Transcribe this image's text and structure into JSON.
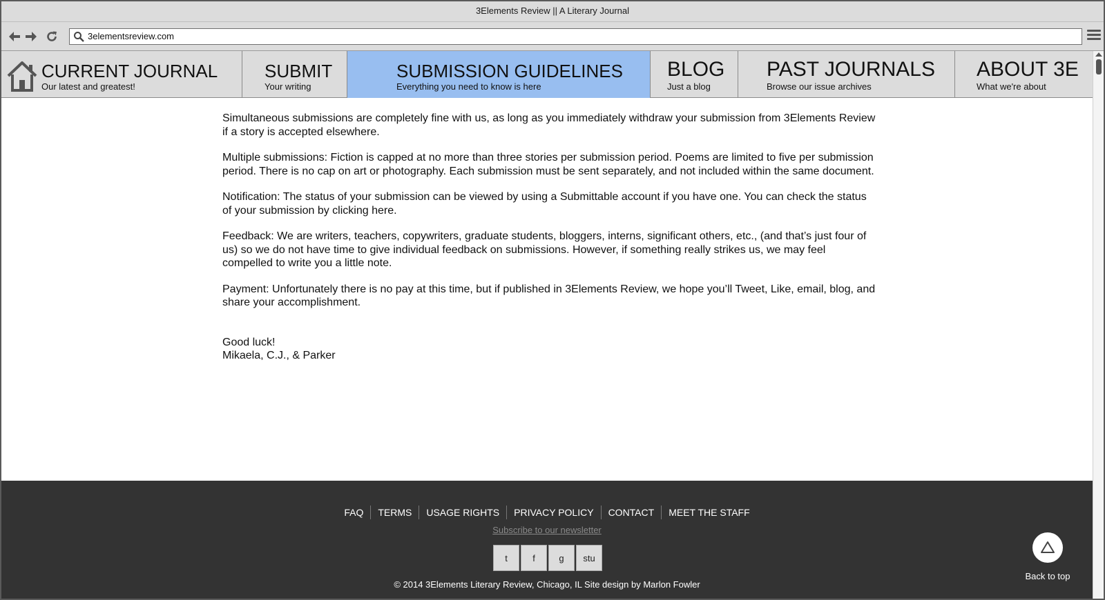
{
  "window": {
    "title": "3Elements Review || A Literary Journal"
  },
  "browser": {
    "url": "3elementsreview.com"
  },
  "nav": {
    "items": [
      {
        "title": "CURRENT JOURNAL",
        "subtitle": "Our latest and greatest!",
        "icon": "home-icon"
      },
      {
        "title": "SUBMIT",
        "subtitle": "Your writing"
      },
      {
        "title": "SUBMISSION GUIDELINES",
        "subtitle": "Everything you need to know is here",
        "active": true
      },
      {
        "title": "BLOG",
        "subtitle": "Just a blog"
      },
      {
        "title": "PAST JOURNALS",
        "subtitle": "Browse our issue archives"
      },
      {
        "title": "ABOUT 3E",
        "subtitle": "What we're about"
      }
    ],
    "active_color": "#98bef0"
  },
  "content": {
    "paragraphs": [
      "Simultaneous submissions are completely fine with us, as long as you immediately withdraw your submission from 3Elements Review if a story is accepted elsewhere.",
      "Multiple submissions: Fiction is capped at no more than three stories per submission period. Poems are limited to five per submission period. There is no cap on art or photography. Each submission must be sent separately, and not included within the same document.",
      "Notification: The status of your submission can be viewed by using a Submittable account if you have one. You can check the status of your submission by clicking here.",
      "Feedback: We are writers, teachers, copywriters, graduate students, bloggers, interns, significant others, etc., (and that’s just four of us) so we do not have time to give individual feedback on submissions. However, if something really strikes us, we may feel compelled to write you a little note.",
      "Payment: Unfortunately there is no pay at this time, but if published in 3Elements Review, we hope you’ll Tweet, Like, email, blog, and share your accomplishment."
    ],
    "closing": "Good luck!",
    "signature": "Mikaela, C.J., & Parker"
  },
  "footer": {
    "links": [
      "FAQ",
      "TERMS",
      "USAGE RIGHTS",
      "PRIVACY POLICY",
      "CONTACT",
      "MEET THE STAFF"
    ],
    "newsletter": "Subscribe to our newsletter",
    "social": [
      "t",
      "f",
      "g",
      "stu"
    ],
    "copyright": "© 2014 3Elements Literary Review, Chicago, IL Site design by Marlon Fowler",
    "back_to_top": "Back to top",
    "background": "#333333"
  }
}
